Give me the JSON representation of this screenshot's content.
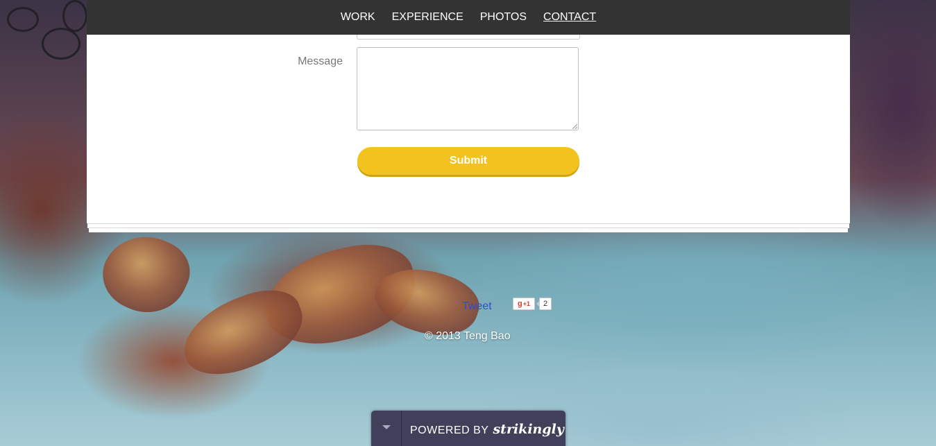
{
  "nav": {
    "items": [
      {
        "label": "WORK"
      },
      {
        "label": "EXPERIENCE"
      },
      {
        "label": "PHOTOS"
      },
      {
        "label": "CONTACT"
      }
    ],
    "active": "CONTACT"
  },
  "form": {
    "message_label": "Message",
    "message_value": "",
    "submit_label": "Submit"
  },
  "social": {
    "tweet_label": "Tweet",
    "gplus_label": "+1",
    "gplus_count": "2"
  },
  "footer": {
    "copyright": "© 2013 Teng Bao"
  },
  "powered": {
    "prefix": "POWERED BY",
    "brand": "strikingly"
  },
  "colors": {
    "nav_bg": "#333333",
    "submit_bg": "#f2c31f",
    "tweet_link": "#2c4fd6",
    "badge_bg": "#40405a"
  }
}
